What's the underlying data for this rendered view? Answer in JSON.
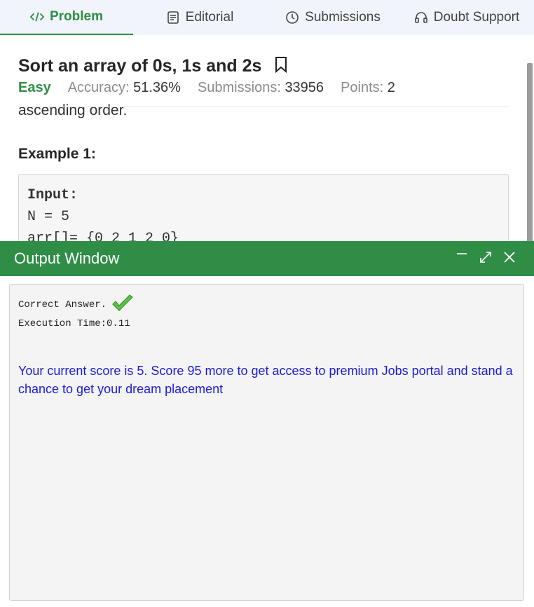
{
  "tabs": [
    {
      "label": "Problem",
      "icon": "code-icon"
    },
    {
      "label": "Editorial",
      "icon": "document-icon"
    },
    {
      "label": "Submissions",
      "icon": "clock-icon"
    },
    {
      "label": "Doubt Support",
      "icon": "headphones-icon"
    }
  ],
  "problem": {
    "title": "Sort an array of 0s, 1s and 2s",
    "difficulty": "Easy",
    "accuracy_label": "Accuracy:",
    "accuracy_value": "51.36%",
    "submissions_label": "Submissions:",
    "submissions_value": "33956",
    "points_label": "Points:",
    "points_value": "2",
    "partial_text": "ascending order.",
    "example_heading": "Example 1:",
    "code_lines": [
      "Input:",
      "N = 5",
      "arr[]= {0 2 1 2 0}"
    ]
  },
  "output": {
    "title": "Output Window",
    "result": "Correct Answer.",
    "exec_time": "Execution Time:0.11",
    "score_message": "Your current score is 5. Score 95 more to get access to premium Jobs portal and stand a chance to get your dream placement"
  },
  "colors": {
    "accent": "#2f8d46",
    "link_blue": "#1b1bd6"
  }
}
